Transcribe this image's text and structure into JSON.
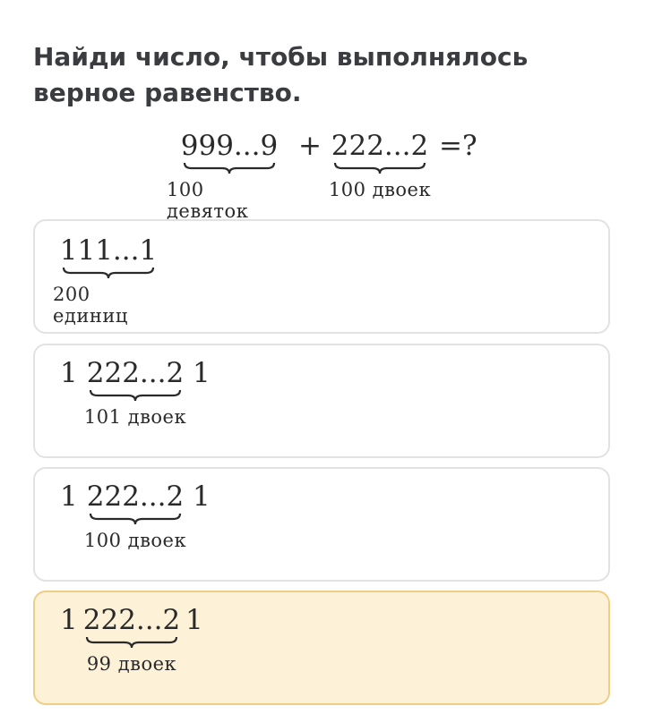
{
  "question": {
    "text": "Найди число, чтобы выполнялось верное равенство."
  },
  "equation": {
    "term1": "999...9",
    "term1_label": "100 девяток",
    "plus": "+",
    "term2": "222...2",
    "term2_label": "100 двоек",
    "equals": "=?"
  },
  "options": [
    {
      "core": "111...1",
      "label": "200 единиц"
    },
    {
      "prefix": "1",
      "core": "222...2",
      "suffix": "1",
      "label": "101 двоек"
    },
    {
      "prefix": "1",
      "core": "222...2",
      "suffix": "1",
      "label": "100 двоек"
    },
    {
      "prefix": "1",
      "core": "222...2",
      "suffix": "1",
      "label": "99 двоек",
      "selected": true
    }
  ],
  "colors": {
    "selected_background": "#fdf2d8",
    "selected_border": "#efcf86",
    "option_border": "#e2e2e2"
  }
}
